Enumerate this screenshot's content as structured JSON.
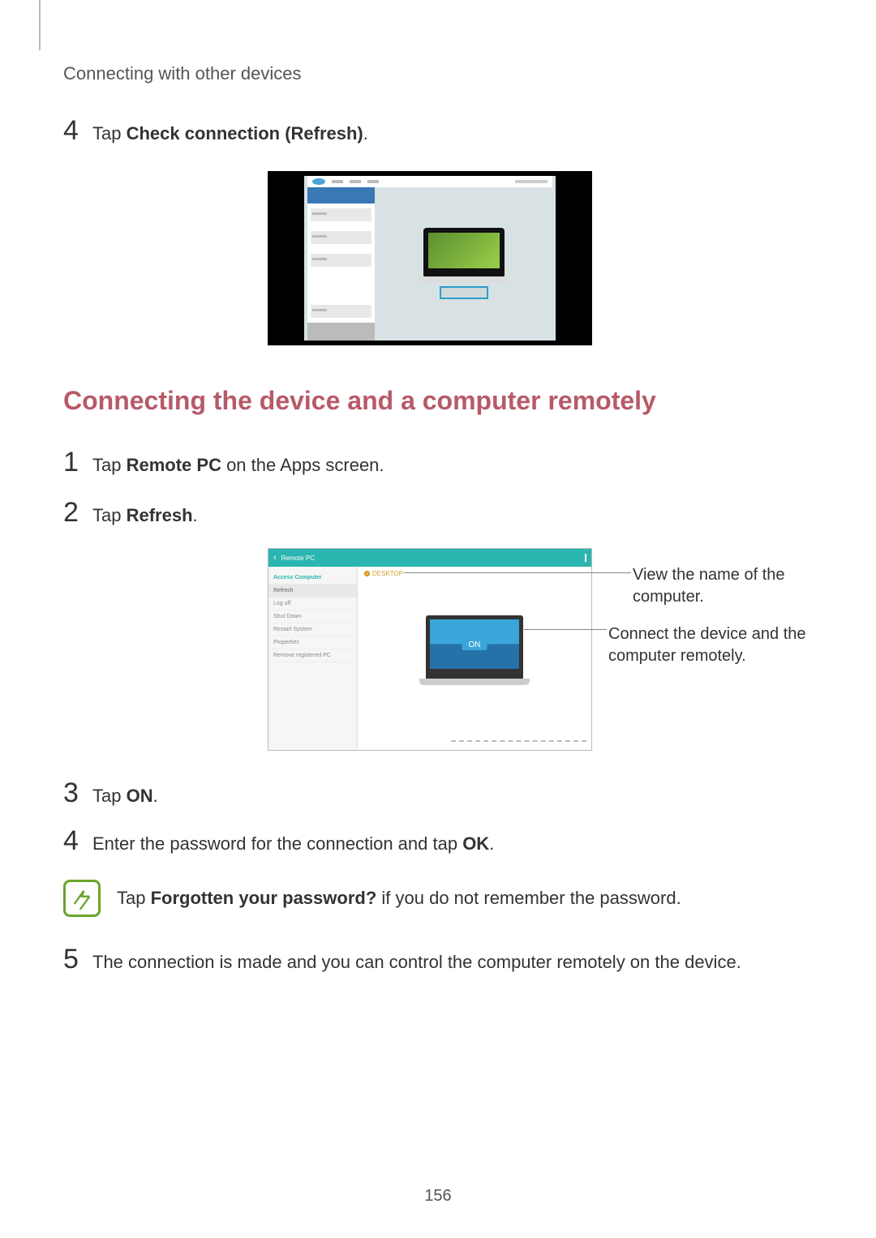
{
  "header": "Connecting with other devices",
  "top_step": {
    "num": "4",
    "pre": "Tap ",
    "bold": "Check connection (Refresh)",
    "post": "."
  },
  "section_heading": "Connecting the device and a computer remotely",
  "steps": [
    {
      "num": "1",
      "pre": "Tap ",
      "bold": "Remote PC",
      "post": " on the Apps screen."
    },
    {
      "num": "2",
      "pre": "Tap ",
      "bold": "Refresh",
      "post": "."
    },
    {
      "num": "3",
      "pre": "Tap ",
      "bold": "ON",
      "post": "."
    },
    {
      "num": "4",
      "pre": "Enter the password for the connection and tap ",
      "bold": "OK",
      "post": "."
    },
    {
      "num": "5",
      "pre": "The connection is made and you can control the computer remotely on the device.",
      "bold": "",
      "post": ""
    }
  ],
  "note": {
    "pre": "Tap ",
    "bold": "Forgotten your password?",
    "post": " if you do not remember the password."
  },
  "callouts": {
    "name": "View the name of the computer.",
    "connect": "Connect the device and the computer remotely."
  },
  "fig2": {
    "title": "Remote PC",
    "pc_label": "DESKTOP",
    "on": "ON",
    "side": [
      "Access Computer",
      "Refresh",
      "Log off",
      "Shut Down",
      "Restart System",
      "Properties",
      "Remove registered PC"
    ]
  },
  "page_num": "156"
}
